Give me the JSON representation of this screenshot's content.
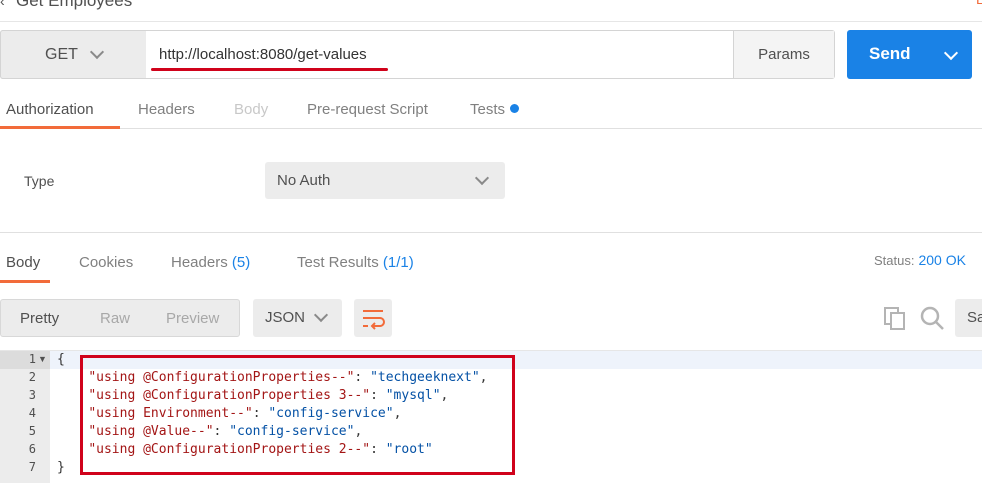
{
  "window": {
    "title": "Get Employees",
    "edge_glyph": "E"
  },
  "request": {
    "method": "GET",
    "url": "http://localhost:8080/get-values",
    "params_label": "Params",
    "send_label": "Send"
  },
  "request_tabs": [
    {
      "label": "Authorization",
      "state": "active"
    },
    {
      "label": "Headers",
      "state": "normal"
    },
    {
      "label": "Body",
      "state": "disabled"
    },
    {
      "label": "Pre-request Script",
      "state": "normal"
    },
    {
      "label": "Tests",
      "state": "normal",
      "dot": true
    }
  ],
  "auth": {
    "type_label": "Type",
    "type_value": "No Auth"
  },
  "response_tabs": {
    "body": "Body",
    "cookies": "Cookies",
    "headers": "Headers",
    "headers_count": "(5)",
    "test_results": "Test Results",
    "test_results_count": "(1/1)"
  },
  "status": {
    "label": "Status:",
    "value": "200 OK"
  },
  "view_modes": [
    "Pretty",
    "Raw",
    "Preview"
  ],
  "format": "JSON",
  "toolbar": {
    "save_partial": "Sa"
  },
  "code": {
    "open_brace": "{",
    "close_brace": "}",
    "entries": [
      {
        "key": "\"using @ConfigurationProperties--\"",
        "value": "\"techgeeknext\"",
        "comma": ","
      },
      {
        "key": "\"using @ConfigurationProperties 3--\"",
        "value": "\"mysql\"",
        "comma": ","
      },
      {
        "key": "\"using Environment--\"",
        "value": "\"config-service\"",
        "comma": ","
      },
      {
        "key": "\"using @Value--\"",
        "value": "\"config-service\"",
        "comma": ","
      },
      {
        "key": "\"using @ConfigurationProperties 2--\"",
        "value": "\"root\"",
        "comma": ""
      }
    ],
    "line_numbers": [
      "1",
      "2",
      "3",
      "4",
      "5",
      "6",
      "7"
    ]
  },
  "colors": {
    "accent_orange": "#f26b3a",
    "send_blue": "#1a82e6",
    "annotation_red": "#d0021b"
  }
}
